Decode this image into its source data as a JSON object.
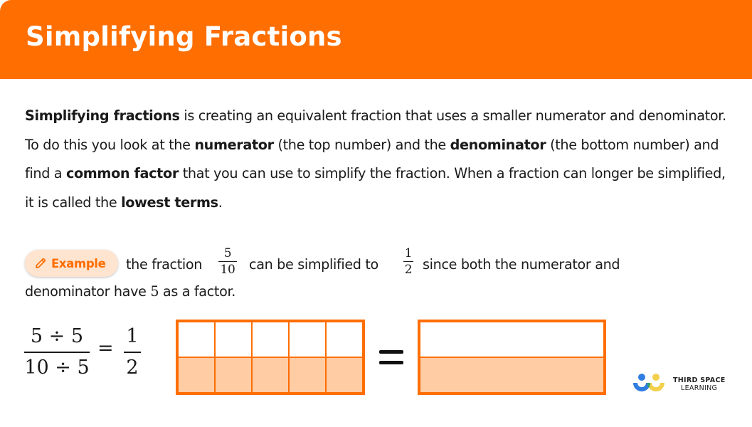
{
  "header": {
    "title": "Simplifying Fractions",
    "color": "#ff6e00"
  },
  "definition": {
    "p1_bold": "Simplifying fractions",
    "p1_rest": " is creating an equivalent fraction that uses a smaller numerator and denominator.",
    "p2_a": "To do this you look at the ",
    "p2_b_bold": "numerator",
    "p2_c": " (the top number) and the ",
    "p2_d_bold": "denominator",
    "p2_e": " (the bottom number) and find a ",
    "p2_f_bold": "common factor",
    "p2_g": " that you can use to simplify the fraction. When a fraction can longer be simplified, it is called the ",
    "p2_h_bold": "lowest terms",
    "p2_i": "."
  },
  "example": {
    "badge_label": "Example",
    "badge_icon": "pencil-icon",
    "text_before": "the fraction",
    "fraction1": {
      "num": "5",
      "den": "10"
    },
    "text_middle": "can be simplified to",
    "fraction2": {
      "num": "1",
      "den": "2"
    },
    "text_after": "since both the numerator and",
    "line2_before": "denominator have ",
    "line2_number": "5",
    "line2_after": " as a factor."
  },
  "equation": {
    "numerator": "5 ÷ 5",
    "denominator": "10 ÷ 5",
    "equals": "=",
    "result_num": "1",
    "result_den": "2"
  },
  "diagram": {
    "left_model": {
      "columns": 5,
      "rows": 2,
      "shaded_row": "bottom",
      "shaded_parts": 5,
      "total_parts": 10
    },
    "right_model": {
      "columns": 1,
      "rows": 2,
      "shaded_row": "bottom",
      "shaded_parts": 1,
      "total_parts": 2
    },
    "equals": "=",
    "border_color": "#ff6e00",
    "shade_color": "#ffcca3"
  },
  "logo": {
    "line1": "THIRD SPACE",
    "line2": "LEARNING"
  }
}
